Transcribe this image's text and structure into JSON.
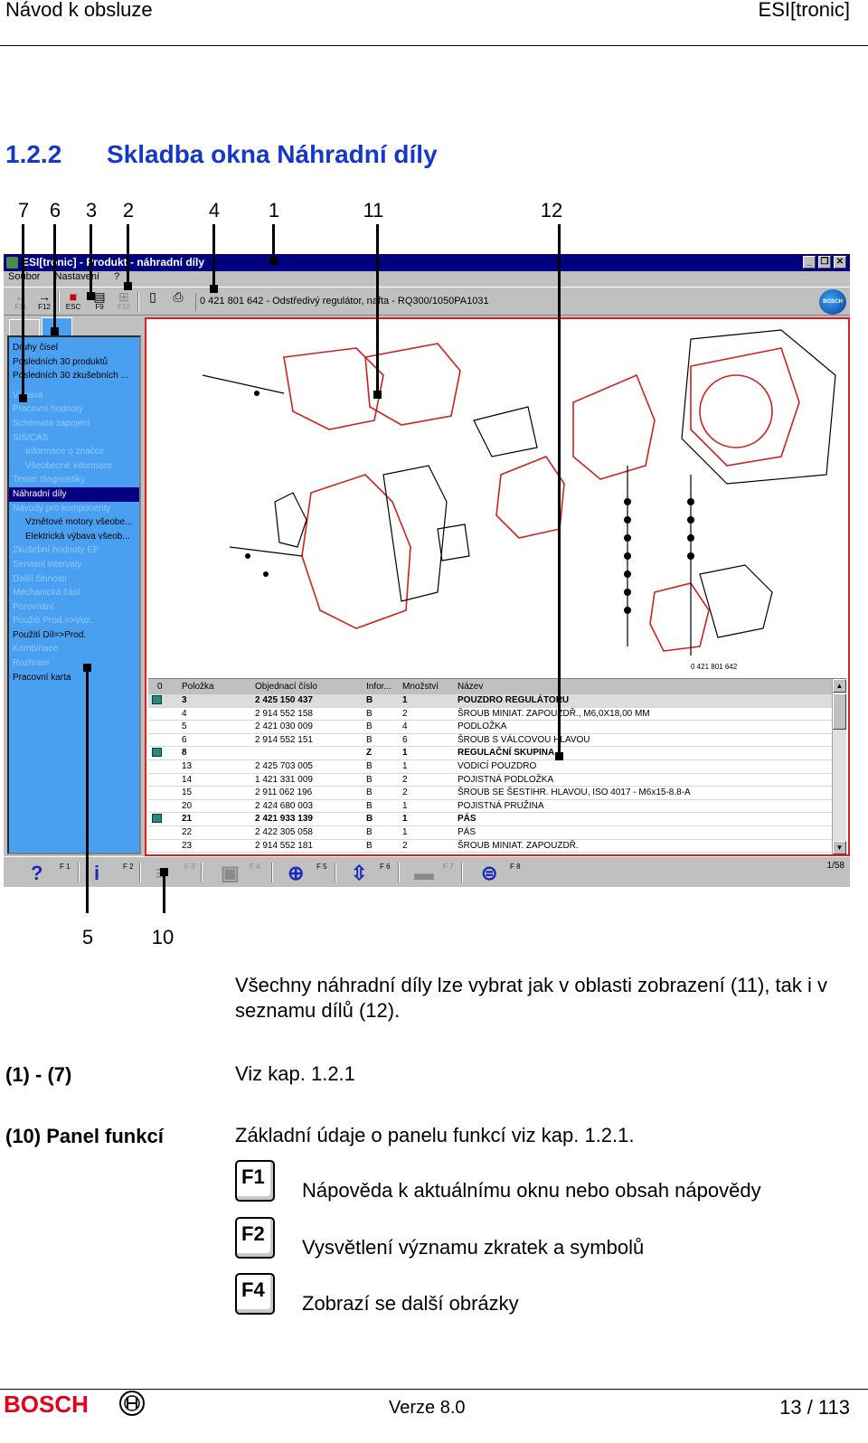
{
  "header": {
    "left": "Návod k obsluze",
    "right": "ESI[tronic]"
  },
  "section": {
    "number": "1.2.2",
    "title": "Skladba okna Náhradní díly"
  },
  "callouts_top": [
    "7",
    "6",
    "3",
    "2",
    "4",
    "1",
    "11",
    "12"
  ],
  "callouts_bottom": [
    "5",
    "10"
  ],
  "screenshot": {
    "window_title": "ESI[tronic] - Produkt - náhradní díly",
    "menu": [
      "Soubor",
      "Nastavení",
      "?"
    ],
    "toolbar": {
      "f11": "F11",
      "f12": "F12",
      "esc": "ESC",
      "f9": "F9",
      "f10": "F10"
    },
    "product": "0 421 801 642 - Odstředivý regulátor, nafta - RQ300/1050PA1031",
    "globe": "BOSCH",
    "tree": [
      {
        "label": "Druhy čísel",
        "style": "on"
      },
      {
        "label": "Posledních 30 produktů",
        "style": "on"
      },
      {
        "label": "Posledních 30 zkušebních ...",
        "style": "on"
      },
      {
        "label": "Výbava",
        "style": "off"
      },
      {
        "label": "Pracovní hodnoty",
        "style": "off"
      },
      {
        "label": "Schémata zapojení",
        "style": "off"
      },
      {
        "label": "SIS/CAS",
        "style": "off"
      },
      {
        "label": "Informace o značce",
        "style": "off ind"
      },
      {
        "label": "Všeobecné informace",
        "style": "off ind"
      },
      {
        "label": "Tester diagnostiky",
        "style": "off"
      },
      {
        "label": "Náhradní díly",
        "style": "sel"
      },
      {
        "label": "Návody pro komponenty",
        "style": "off"
      },
      {
        "label": "Vznětové motory všeobe...",
        "style": "on ind"
      },
      {
        "label": "Elektrická výbava všeob...",
        "style": "on ind"
      },
      {
        "label": "Zkušební hodnoty EP",
        "style": "off"
      },
      {
        "label": "Servisní intervaly",
        "style": "off"
      },
      {
        "label": "Další činnosti",
        "style": "off"
      },
      {
        "label": "Mechanická část",
        "style": "off"
      },
      {
        "label": "Porovnání",
        "style": "off"
      },
      {
        "label": "Použití Prod.=>Voz.",
        "style": "off"
      },
      {
        "label": "Použití Díl=>Prod.",
        "style": "on"
      },
      {
        "label": "Kombinace",
        "style": "off"
      },
      {
        "label": "Rozhraní",
        "style": "off"
      },
      {
        "label": "Pracovní karta",
        "style": "on"
      }
    ],
    "parts_header": [
      "0",
      "Položka",
      "Objednací číslo",
      "Infor...",
      "Množství",
      "Název"
    ],
    "parts": [
      {
        "icon": true,
        "pos": "3",
        "order": "2 425 150 437",
        "info": "B",
        "qty": "1",
        "name": "POUZDRO REGULÁTORU",
        "bold": true
      },
      {
        "icon": false,
        "pos": "4",
        "order": "2 914 552 158",
        "info": "B",
        "qty": "2",
        "name": "ŠROUB MINIAT. ZAPOUZDŘ.,    M6,0X18,00 MM",
        "bold": false
      },
      {
        "icon": false,
        "pos": "5",
        "order": "2 421 030 009",
        "info": "B",
        "qty": "4",
        "name": "PODLOŽKA",
        "bold": false
      },
      {
        "icon": false,
        "pos": "6",
        "order": "2 914 552 151",
        "info": "B",
        "qty": "6",
        "name": "ŠROUB S VÁLCOVOU HLAVOU",
        "bold": false
      },
      {
        "icon": true,
        "pos": "8",
        "order": "",
        "info": "Z",
        "qty": "1",
        "name": "REGULAČNÍ SKUPINA",
        "bold": true
      },
      {
        "icon": false,
        "pos": "13",
        "order": "2 425 703 005",
        "info": "B",
        "qty": "1",
        "name": "VODICÍ POUZDRO",
        "bold": false
      },
      {
        "icon": false,
        "pos": "14",
        "order": "1 421 331 009",
        "info": "B",
        "qty": "2",
        "name": "POJISTNÁ PODLOŽKA",
        "bold": false
      },
      {
        "icon": false,
        "pos": "15",
        "order": "2 911 062 196",
        "info": "B",
        "qty": "2",
        "name": "ŠROUB SE ŠESTIHR. HLAVOU,   ISO 4017 - M6x15-8.8-A",
        "bold": false
      },
      {
        "icon": false,
        "pos": "20",
        "order": "2 424 680 003",
        "info": "B",
        "qty": "1",
        "name": "POJISTNÁ PRUŽINA",
        "bold": false
      },
      {
        "icon": true,
        "pos": "21",
        "order": "2 421 933 139",
        "info": "B",
        "qty": "1",
        "name": "PÁS",
        "bold": true
      },
      {
        "icon": false,
        "pos": "22",
        "order": "2 422 305 058",
        "info": "B",
        "qty": "1",
        "name": "PÁS",
        "bold": false
      },
      {
        "icon": false,
        "pos": "23",
        "order": "2 914 552 181",
        "info": "B",
        "qty": "2",
        "name": "ŠROUB MINIAT. ZAPOUZDŘ.",
        "bold": false
      }
    ],
    "drawing_number": "0 421 801 642",
    "fkeys": [
      "F 1",
      "F 2",
      "F 3",
      "F 4",
      "F 5",
      "F 6",
      "F 7",
      "F 8"
    ],
    "page_counter": "1/58"
  },
  "body": {
    "intro": "Všechny náhradní díly lze vybrat jak v oblasti zobrazení (11), tak i v seznamu dílů (12).",
    "item1_term": "(1) - (7)",
    "item1_desc": "Viz kap. 1.2.1",
    "item2_term": "(10) Panel funkcí",
    "item2_desc": "Základní údaje o panelu funkcí viz kap. 1.2.1.",
    "keys": [
      {
        "key": "F1",
        "desc": "Nápověda k aktuálnímu oknu nebo obsah nápovědy"
      },
      {
        "key": "F2",
        "desc": "Vysvětlení významu zkratek a symbolů"
      },
      {
        "key": "F4",
        "desc": "Zobrazí se další obrázky"
      }
    ]
  },
  "footer": {
    "brand": "BOSCH",
    "version": "Verze 8.0",
    "page": "13 / 113"
  },
  "colors": {
    "section_title": "#1438c8",
    "brand_red": "#e2001a",
    "tree_blue": "#4aa0f0",
    "highlight_red": "#e02020"
  }
}
